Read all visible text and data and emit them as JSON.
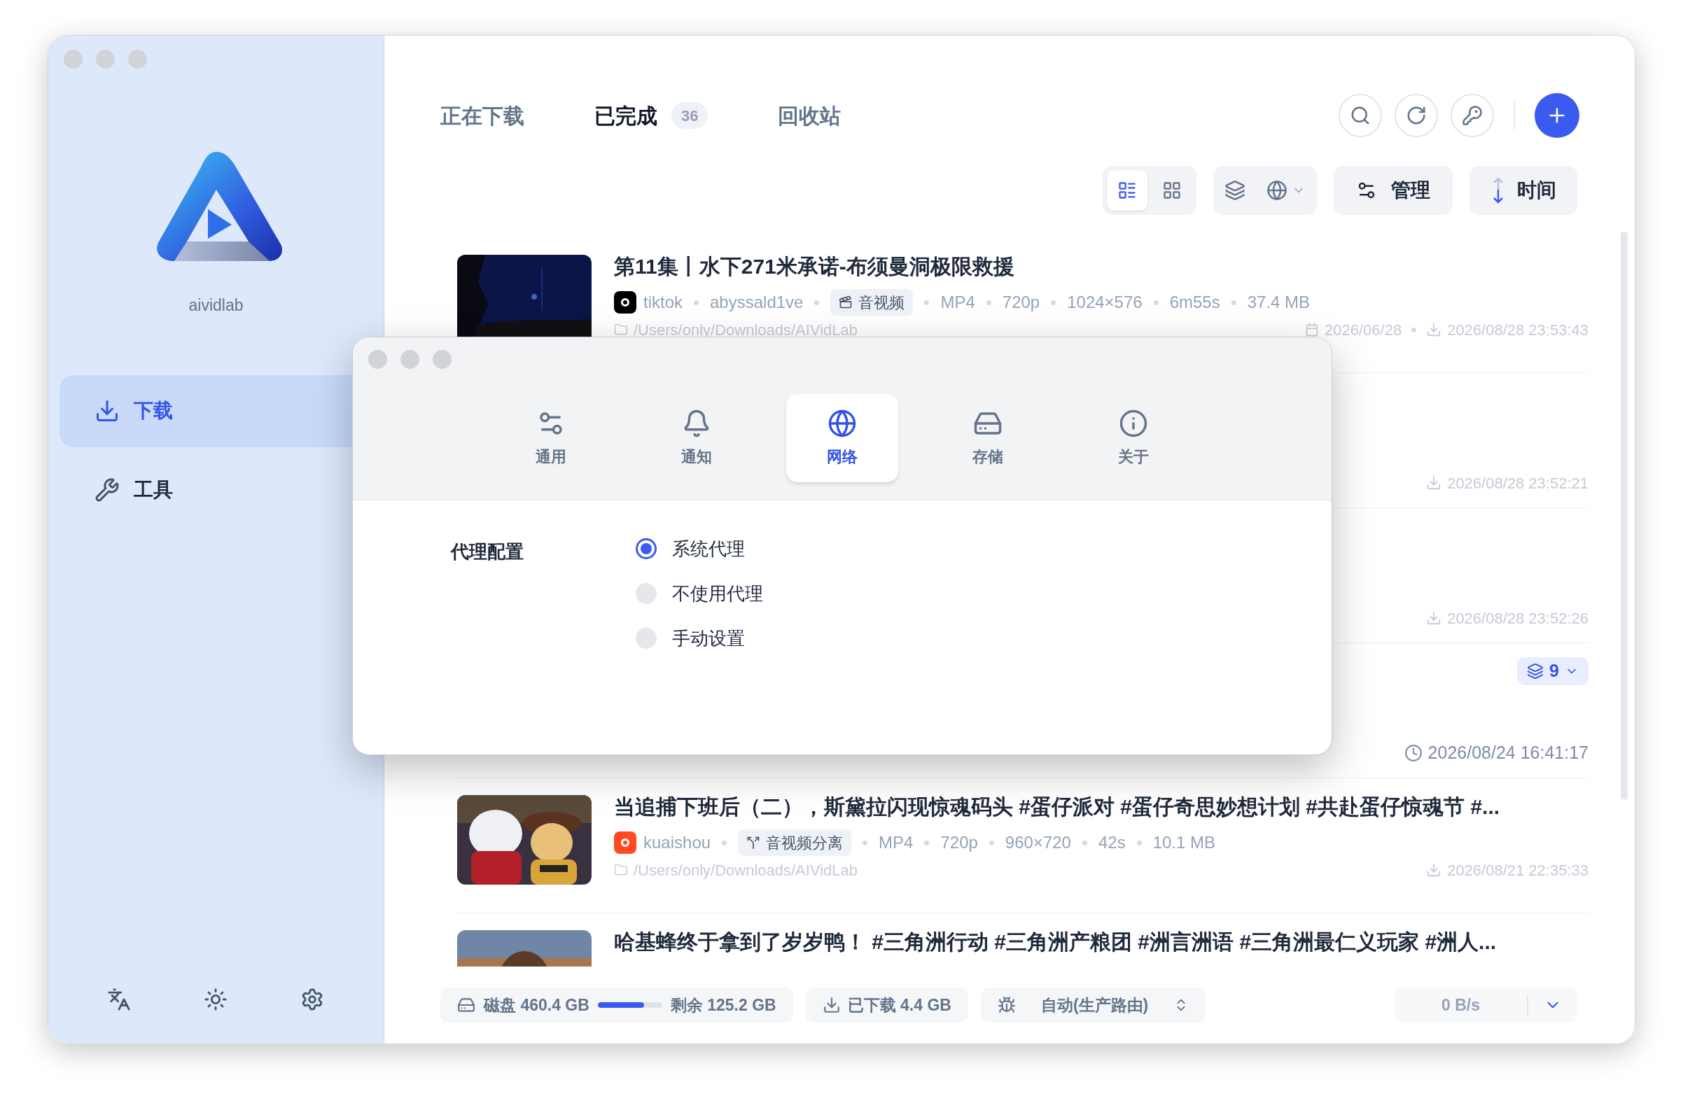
{
  "sidebar": {
    "app_name": "aividlab",
    "nav": [
      {
        "label": "下载",
        "selected": true
      },
      {
        "label": "工具",
        "selected": false
      }
    ]
  },
  "header": {
    "tabs": [
      {
        "label": "正在下载",
        "selected": false
      },
      {
        "label": "已完成",
        "selected": true,
        "count": "36"
      },
      {
        "label": "回收站",
        "selected": false
      }
    ]
  },
  "toolbar": {
    "views": [
      {
        "kind": "list",
        "selected": true
      },
      {
        "kind": "grid",
        "selected": false
      }
    ],
    "manage": "管理",
    "sort": "时间"
  },
  "items": [
    {
      "thumbnail": {
        "kind": "picture"
      },
      "title": "第11集丨水下271米承诺-布须曼洞极限救援",
      "source": {
        "name": "tiktok",
        "color": "#000000"
      },
      "author": "abyssald1ve",
      "tag": {
        "label": "音视频",
        "kind": "av"
      },
      "specs": [
        "MP4",
        "720p",
        "1024×576",
        "6m55s",
        "37.4 MB"
      ],
      "path": "/Users/only/Downloads/AIVidLab",
      "created": "2026/06/28",
      "time": {
        "kind": "download",
        "text": "2026/08/28 23:53:43"
      }
    },
    {
      "time": {
        "kind": "download",
        "text": "2026/08/28 23:52:21"
      }
    },
    {
      "time": {
        "kind": "download",
        "text": "2026/08/28 23:52:26"
      }
    },
    {
      "badge": "9",
      "time": {
        "kind": "clock",
        "text": "2026/08/24 16:41:17"
      }
    },
    {
      "thumbnail": {
        "kind": "picture"
      },
      "title": "当追捕下班后（二），斯黛拉闪现惊魂码头 #蛋仔派对 #蛋仔奇思妙想计划 #共赴蛋仔惊魂节 #...",
      "source": {
        "name": "kuaishou",
        "color": "#ff4b1f"
      },
      "tag": {
        "label": "音视频分离",
        "kind": "split"
      },
      "specs": [
        "MP4",
        "720p",
        "960×720",
        "42s",
        "10.1 MB"
      ],
      "path": "/Users/only/Downloads/AIVidLab",
      "time": {
        "kind": "download",
        "text": "2026/08/21 22:35:33"
      }
    },
    {
      "thumbnail": {
        "kind": "picture"
      },
      "title": "哈基蜂终于拿到了岁岁鸭！ #三角洲行动 #三角洲产粮团 #洲言洲语 #三角洲最仁义玩家 #洲人..."
    }
  ],
  "status_bar": {
    "disk": "磁盘 460.4 GB",
    "disk_usage": {
      "level": 0.72
    },
    "free": "剩余 125.2 GB",
    "downloaded": "已下载 4.4 GB",
    "route": "自动(生产路由)",
    "speed": "0 B/s"
  },
  "dialog": {
    "tabs": [
      {
        "label": "通用",
        "selected": false
      },
      {
        "label": "通知",
        "selected": false
      },
      {
        "label": "网络",
        "selected": true
      },
      {
        "label": "存储",
        "selected": false
      },
      {
        "label": "关于",
        "selected": false
      }
    ],
    "setting": {
      "label": "代理配置",
      "options": [
        {
          "label": "系统代理",
          "selected": true
        },
        {
          "label": "不使用代理",
          "selected": false
        },
        {
          "label": "手动设置",
          "selected": false
        }
      ]
    }
  }
}
